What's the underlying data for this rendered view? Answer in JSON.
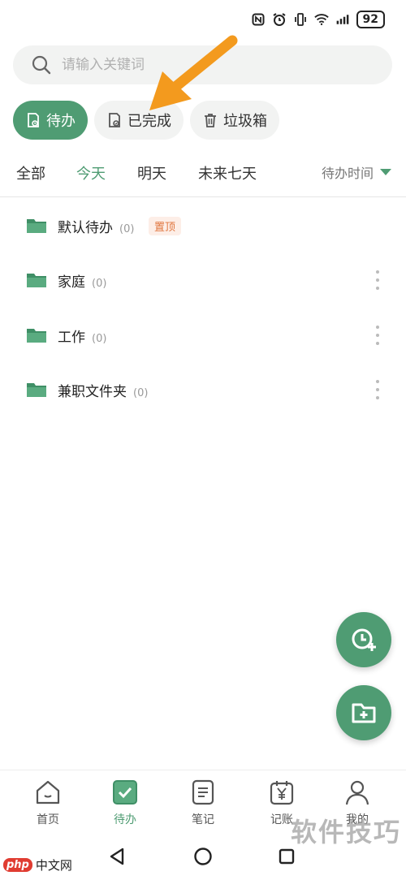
{
  "status_bar": {
    "battery": "92"
  },
  "search": {
    "placeholder": "请输入关键词"
  },
  "filter_chips": [
    {
      "label": "待办",
      "icon": "todo-doc-icon"
    },
    {
      "label": "已完成",
      "icon": "done-doc-icon"
    },
    {
      "label": "垃圾箱",
      "icon": "trash-icon"
    }
  ],
  "date_tabs": [
    {
      "label": "全部"
    },
    {
      "label": "今天"
    },
    {
      "label": "明天"
    },
    {
      "label": "未来七天"
    }
  ],
  "active_date_tab": "今天",
  "sort": {
    "label": "待办时间"
  },
  "folders": [
    {
      "name": "默认待办",
      "count": "(0)",
      "badge": "置顶"
    },
    {
      "name": "家庭",
      "count": "(0)"
    },
    {
      "name": "工作",
      "count": "(0)"
    },
    {
      "name": "兼职文件夹",
      "count": "(0)"
    }
  ],
  "bottom_nav": [
    {
      "label": "首页",
      "icon": "home-icon"
    },
    {
      "label": "待办",
      "icon": "todo-check-icon"
    },
    {
      "label": "笔记",
      "icon": "notes-icon"
    },
    {
      "label": "记账",
      "icon": "calendar-yen-icon"
    },
    {
      "label": "我的",
      "icon": "person-icon"
    }
  ],
  "active_nav": "待办",
  "watermark": {
    "right": "软件技巧",
    "left_brand": "php",
    "left_text": "中文网"
  },
  "colors": {
    "accent": "#4f9c73",
    "badge_bg": "#fdeee7",
    "badge_text": "#e0763f",
    "arrow": "#f39a1e"
  }
}
